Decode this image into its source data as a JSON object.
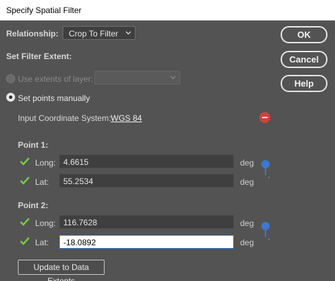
{
  "window": {
    "title": "Specify Spatial Filter"
  },
  "relationship": {
    "label": "Relationship:",
    "value": "Crop To Filter"
  },
  "section_extent": "Set Filter Extent:",
  "use_extents": {
    "label": "Use extents of layer:",
    "value": ""
  },
  "set_points": {
    "label": "Set points manually"
  },
  "coord_system": {
    "label": "Input Coordinate System:",
    "value": "WGS 84"
  },
  "point1": {
    "label": "Point 1:",
    "long": {
      "label": "Long:",
      "value": "4.6615",
      "unit": "deg"
    },
    "lat": {
      "label": "Lat:",
      "value": "55.2534",
      "unit": "deg"
    }
  },
  "point2": {
    "label": "Point 2:",
    "long": {
      "label": "Long:",
      "value": "116.7628",
      "unit": "deg"
    },
    "lat": {
      "label": "Lat:",
      "value": "-18.0892",
      "unit": "deg"
    }
  },
  "buttons": {
    "ok": "OK",
    "cancel": "Cancel",
    "help": "Help",
    "update": "Update to Data Extents"
  },
  "colors": {
    "background": "#535353",
    "check": "#7ac943",
    "pin": "#3b78d0",
    "remove": "#d04141"
  },
  "icons": {
    "check": "checkmark-icon",
    "pin": "map-pin-icon",
    "remove": "remove-icon",
    "chevron": "chevron-down-icon"
  }
}
